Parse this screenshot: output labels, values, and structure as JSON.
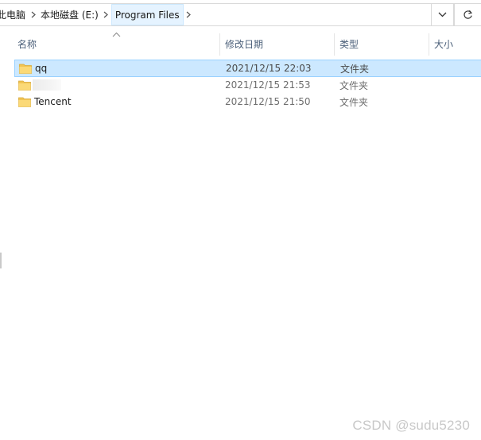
{
  "breadcrumb": {
    "items": [
      "此电脑",
      "本地磁盘 (E:)",
      "Program Files"
    ]
  },
  "columns": {
    "name": "名称",
    "date": "修改日期",
    "type": "类型",
    "size": "大小"
  },
  "files": [
    {
      "name": "qq",
      "date": "2021/12/15 22:03",
      "type": "文件夹",
      "selected": true
    },
    {
      "name": "",
      "date": "2021/12/15 21:53",
      "type": "文件夹",
      "selected": false
    },
    {
      "name": "Tencent",
      "date": "2021/12/15 21:50",
      "type": "文件夹",
      "selected": false
    }
  ],
  "watermark": "CSDN @sudu5230",
  "colors": {
    "selection": "#cce8ff",
    "selection_border": "#99d1ff",
    "header_text": "#4c607a",
    "folder": "#f8d775"
  }
}
